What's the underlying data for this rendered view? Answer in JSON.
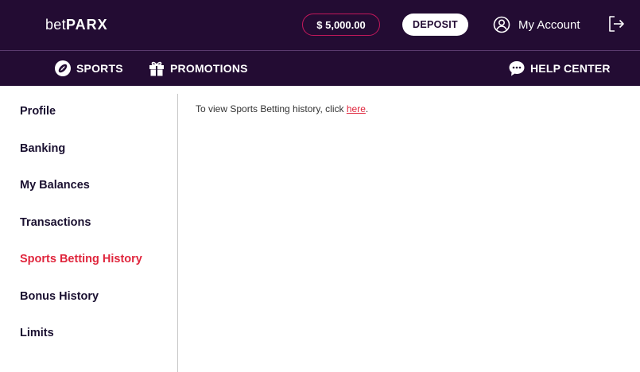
{
  "brand": {
    "logo_light": "bet",
    "logo_bold": "PARX"
  },
  "header": {
    "balance": "$ 5,000.00",
    "deposit_label": "DEPOSIT",
    "account_label": "My Account"
  },
  "nav": {
    "sports_label": "SPORTS",
    "promotions_label": "PROMOTIONS",
    "help_label": "HELP CENTER"
  },
  "sidebar": {
    "items": [
      {
        "label": "Profile",
        "active": false
      },
      {
        "label": "Banking",
        "active": false
      },
      {
        "label": "My Balances",
        "active": false
      },
      {
        "label": "Transactions",
        "active": false
      },
      {
        "label": "Sports Betting History",
        "active": true
      },
      {
        "label": "Bonus History",
        "active": false
      },
      {
        "label": "Limits",
        "active": false
      }
    ]
  },
  "content": {
    "text_before": "To view Sports Betting history, click ",
    "link_label": "here",
    "text_after": "."
  },
  "colors": {
    "header_bg": "#230c33",
    "accent_red": "#e0263d",
    "balance_border": "#c2185b"
  }
}
